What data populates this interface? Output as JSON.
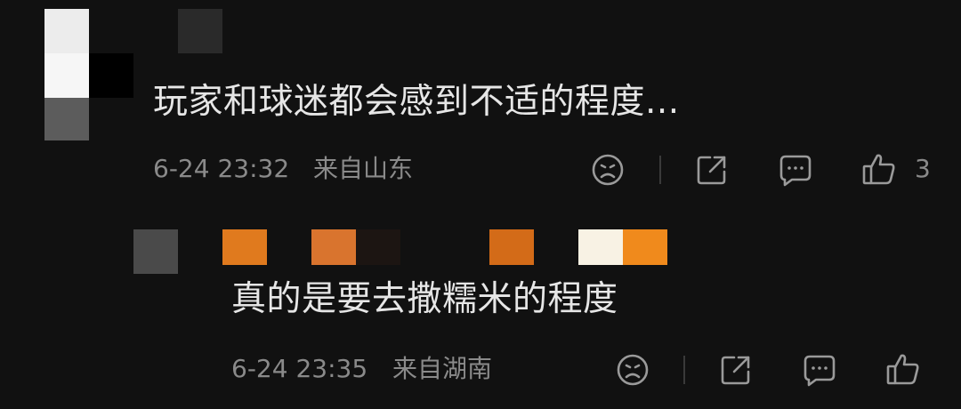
{
  "comments": [
    {
      "text": "玩家和球迷都会感到不适的程度...",
      "time": "6-24 23:32",
      "location": "来自山东",
      "like_count": "3",
      "icons": [
        "sad-face-icon",
        "share-icon",
        "comment-icon",
        "thumbs-up-icon"
      ]
    },
    {
      "text": "真的是要去撒糯米的程度",
      "time": "6-24 23:35",
      "location": "来自湖南",
      "like_count": "",
      "icons": [
        "sad-face-icon",
        "share-icon",
        "comment-icon",
        "thumbs-up-icon"
      ]
    }
  ],
  "colors": {
    "background": "#111111",
    "text": "#e6e6e6",
    "meta": "#8a8a8a",
    "icon": "#9a9a9a",
    "badge_orange": "#e07a1e"
  }
}
